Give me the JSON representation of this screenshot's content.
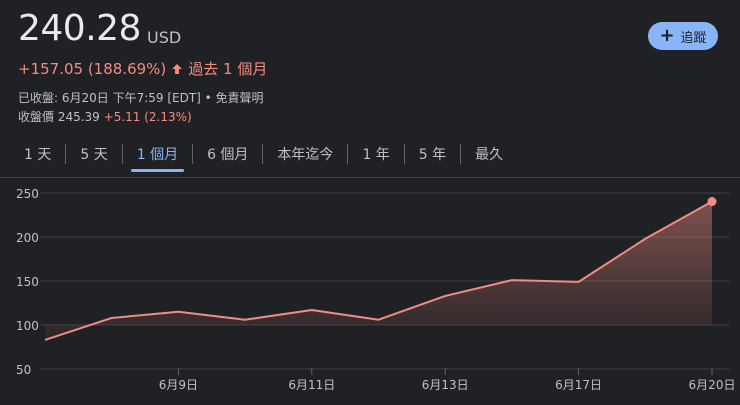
{
  "quote": {
    "price": "240.28",
    "currency": "USD",
    "change": "+157.05 (188.69%)",
    "period": "過去 1 個月",
    "close_info": "已收盤: 6月20日 下午7:59 [EDT] • 免責聲明",
    "close_price_label": "收盤價 245.39",
    "after_change": "+5.11 (2.13%)"
  },
  "follow_button": {
    "label": "追蹤",
    "icon": "plus-icon"
  },
  "tabs": [
    {
      "label": "1 天",
      "active": false
    },
    {
      "label": "5 天",
      "active": false
    },
    {
      "label": "1 個月",
      "active": true
    },
    {
      "label": "6 個月",
      "active": false
    },
    {
      "label": "本年迄今",
      "active": false
    },
    {
      "label": "1 年",
      "active": false
    },
    {
      "label": "5 年",
      "active": false
    },
    {
      "label": "最久",
      "active": false
    }
  ],
  "colors": {
    "line": "#f28b82",
    "accent": "#8ab4f8",
    "background": "#202124"
  },
  "chart_data": {
    "type": "area",
    "y_ticks": [
      50,
      100,
      150,
      200,
      250
    ],
    "ylim": [
      50,
      250
    ],
    "x_tick_labels": [
      "6月9日",
      "6月11日",
      "6月13日",
      "6月17日",
      "6月20日"
    ],
    "x_tick_index": [
      2,
      4,
      6,
      8,
      10
    ],
    "points": [
      83,
      108,
      115,
      106,
      117,
      106,
      133,
      151,
      149,
      198,
      240.28
    ],
    "grid": true
  }
}
